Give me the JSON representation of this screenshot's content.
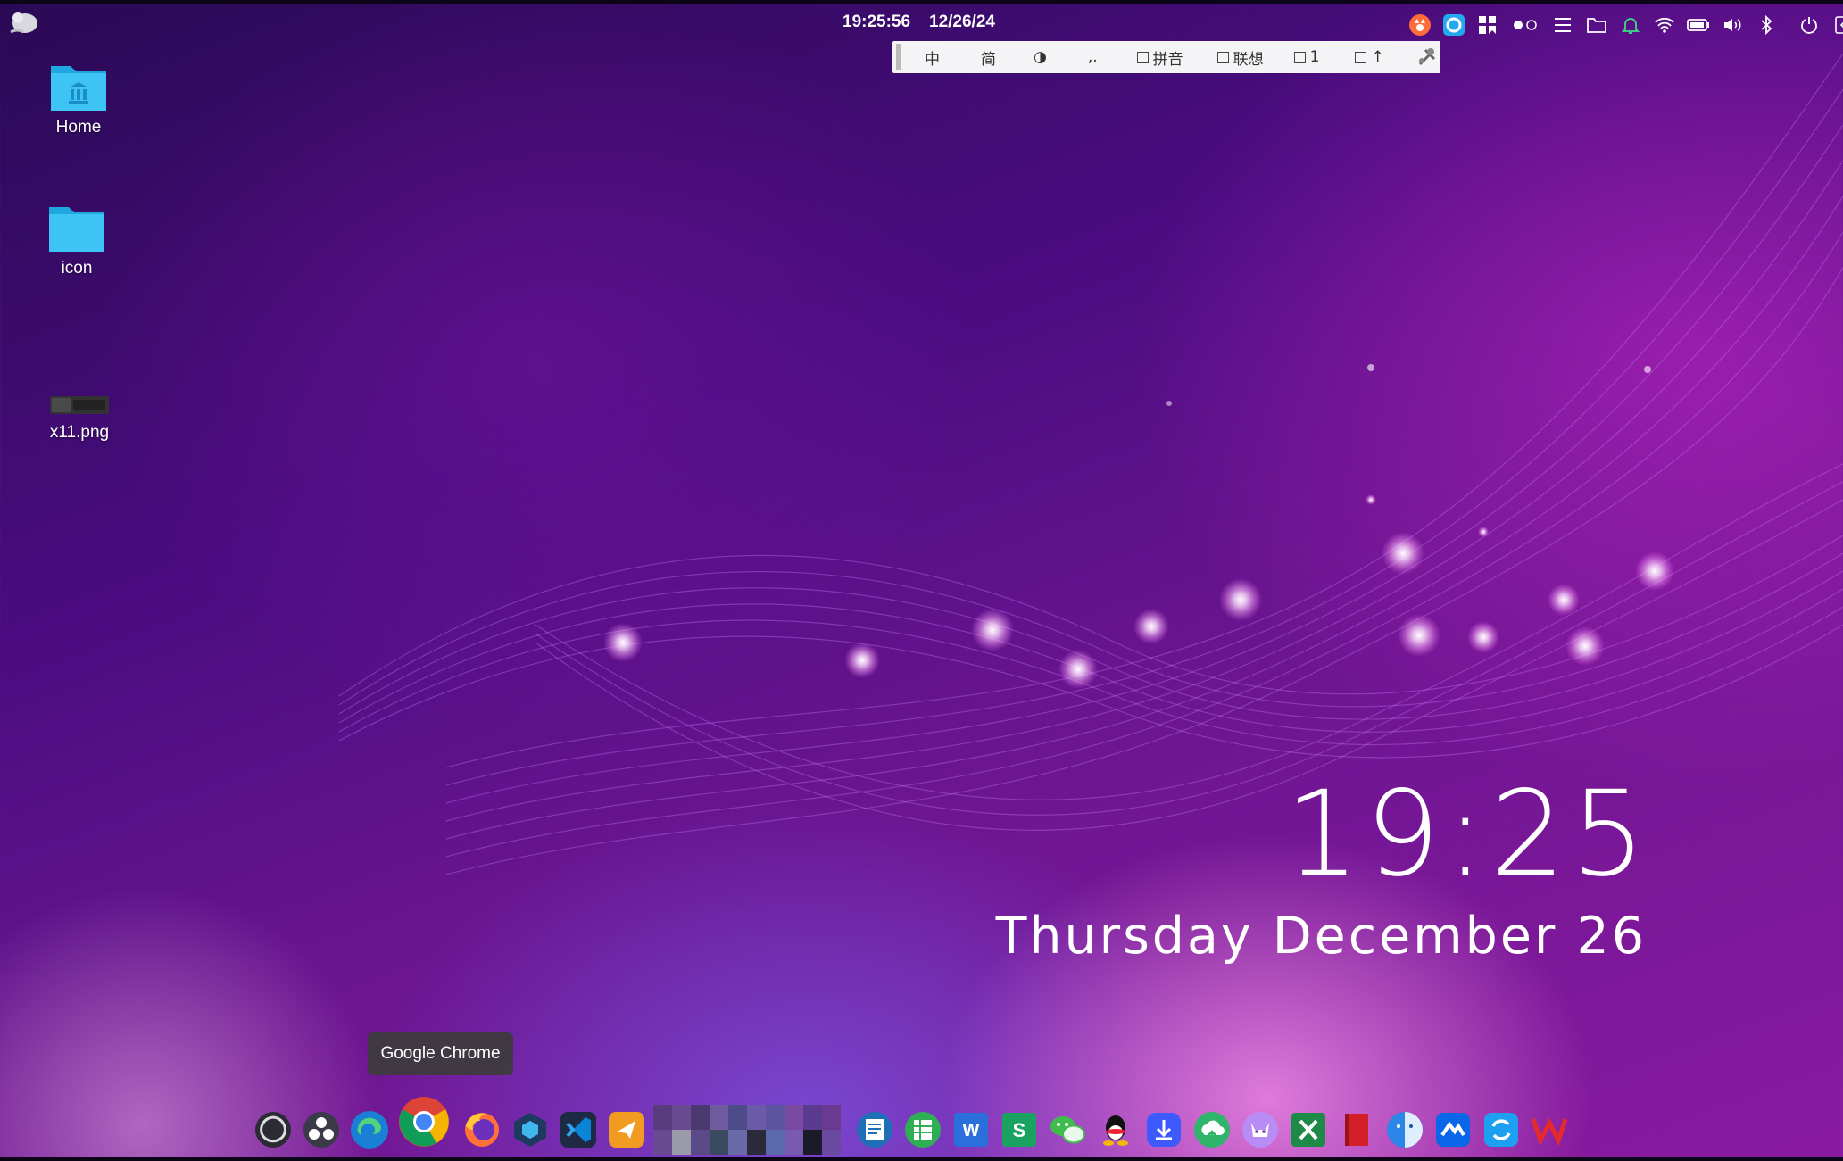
{
  "topbar": {
    "time": "19:25:56",
    "date": "12/26/24",
    "tray_icons": [
      "fox-app-icon",
      "sync-app-icon",
      "layout-app-icon",
      "dots-toggle-icon",
      "menu-lines-icon",
      "folder-icon",
      "bell-icon",
      "wifi-icon",
      "battery-icon",
      "volume-icon",
      "bluetooth-icon",
      "power-icon",
      "collapse-panel-icon"
    ]
  },
  "ime_toolbar": {
    "items": [
      "中",
      "简",
      "◑",
      ",.",
      "拼音",
      "联想",
      "1",
      "↑"
    ]
  },
  "desktop": {
    "icons": [
      {
        "label": "Home"
      },
      {
        "label": "icon"
      },
      {
        "label": "x11.png"
      }
    ]
  },
  "clock_widget": {
    "time": "19:25",
    "date": "Thursday December 26"
  },
  "tooltip": {
    "text": "Google Chrome"
  },
  "dock": {
    "apps": [
      "obs-studio-icon",
      "color-picker-icon",
      "edge-browser-icon",
      "google-chrome-icon",
      "firefox-icon",
      "app-cube-icon",
      "vscode-icon",
      "sender-app-icon",
      "document-viewer-icon",
      "spreadsheet-icon",
      "word-icon",
      "wps-sheets-icon",
      "wechat-icon",
      "qq-icon",
      "download-manager-icon",
      "cloud-upload-icon",
      "cat-app-icon",
      "excel-icon",
      "book-icon",
      "finder-icon",
      "baidu-netdisk-icon",
      "sync-icon",
      "wps-icon"
    ]
  },
  "colors": {
    "accent": "#8a1aa0",
    "folder": "#3ec4f4"
  }
}
